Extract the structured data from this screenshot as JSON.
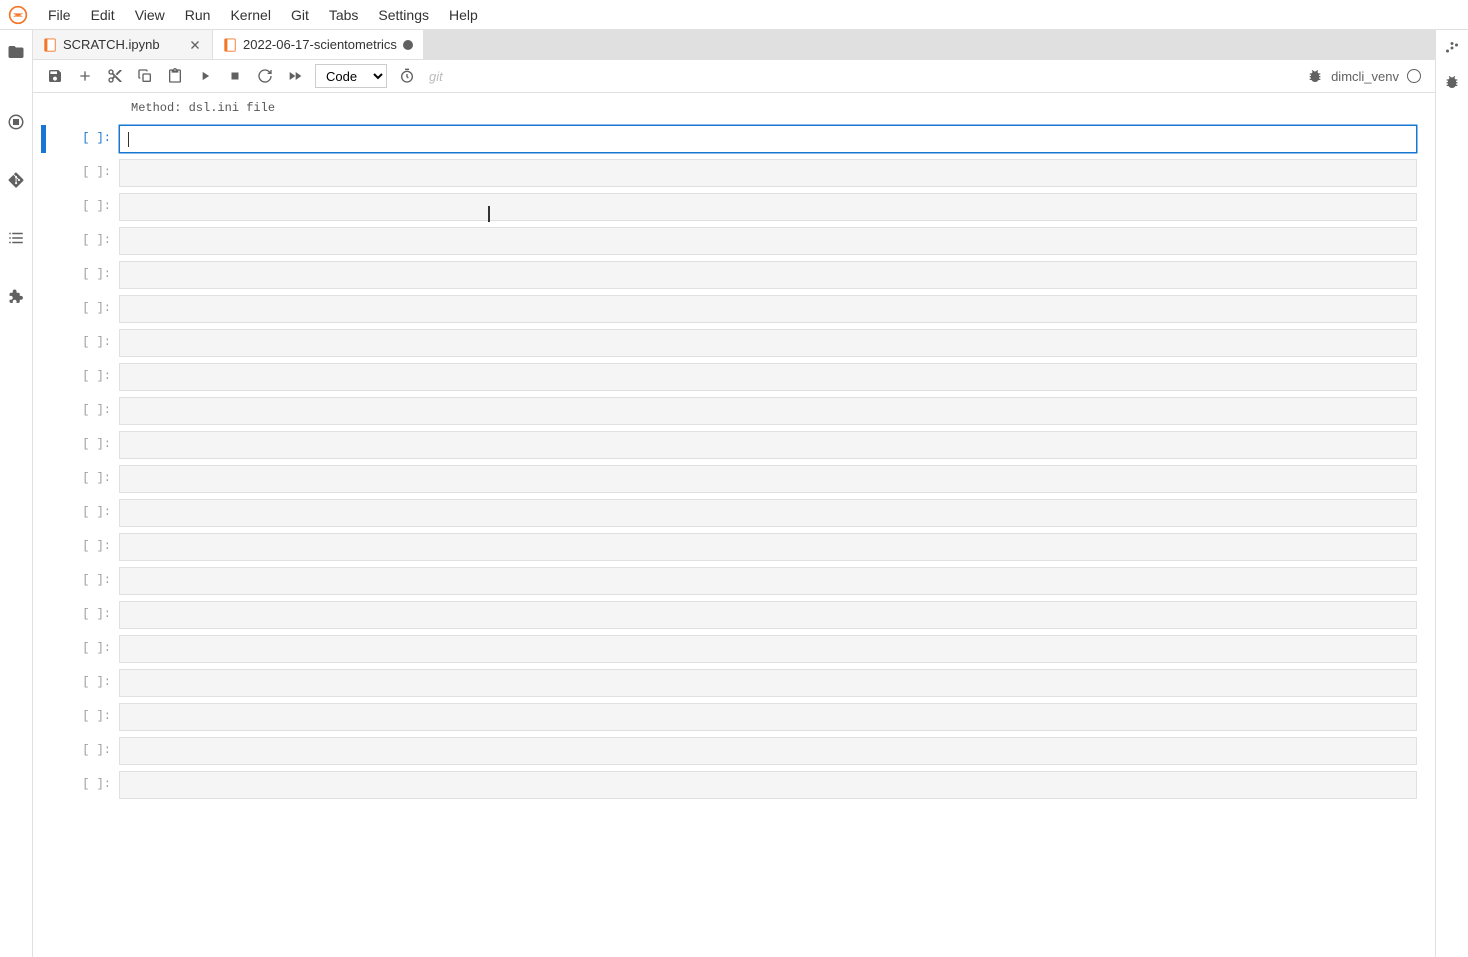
{
  "menubar": {
    "items": [
      "File",
      "Edit",
      "View",
      "Run",
      "Kernel",
      "Git",
      "Tabs",
      "Settings",
      "Help"
    ]
  },
  "tabs": [
    {
      "title": "SCRATCH.ipynb",
      "active": false,
      "dirty": false
    },
    {
      "title": "2022-06-17-scientometrics",
      "active": true,
      "dirty": true
    }
  ],
  "toolbar": {
    "cell_type": "Code",
    "git_label": "git",
    "kernel_name": "dimcli_venv"
  },
  "truncated_output": "Method: dsl.ini file",
  "cells": {
    "prompt": "[ ]:",
    "count": 20,
    "selected_index": 0
  }
}
